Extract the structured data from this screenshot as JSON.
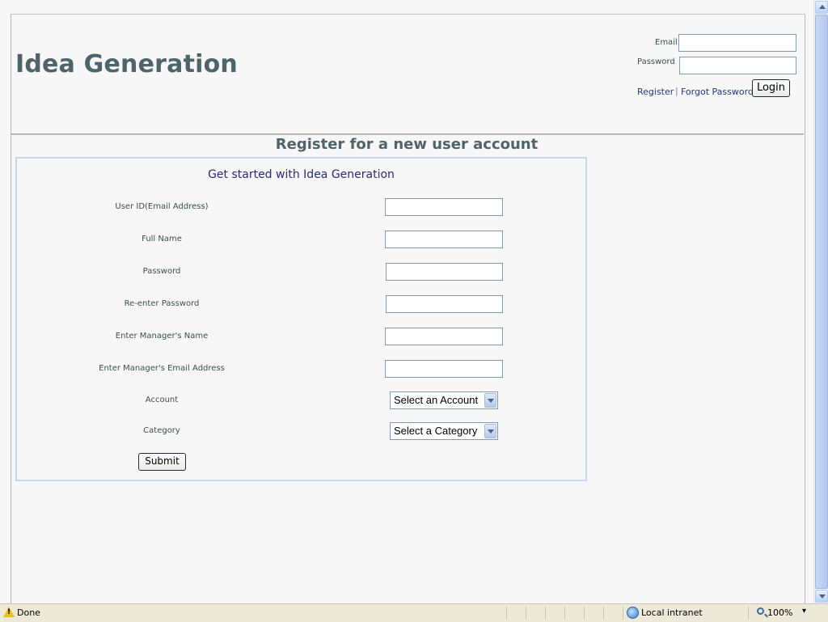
{
  "header": {
    "site_title": "Idea Generation",
    "email_label": "Email",
    "password_label": "Password",
    "register_link": "Register",
    "separator": "|",
    "forgot_link": "Forgot Password",
    "login_button": "Login"
  },
  "main": {
    "page_heading": "Register for a new user account",
    "panel_title": "Get started with Idea Generation",
    "fields": [
      {
        "label": "User ID(Email Address)"
      },
      {
        "label": "Full Name"
      },
      {
        "label": "Password"
      },
      {
        "label": "Re-enter Password"
      },
      {
        "label": "Enter Manager's Name"
      },
      {
        "label": "Enter Manager's Email Address"
      }
    ],
    "account_label": "Account",
    "account_selected": "Select an Account",
    "category_label": "Category",
    "category_selected": "Select a Category",
    "submit_button": "Submit"
  },
  "statusbar": {
    "status_text": "Done",
    "zone_text": "Local intranet",
    "zoom_text": "100%",
    "zoom_arrow": "▾"
  }
}
